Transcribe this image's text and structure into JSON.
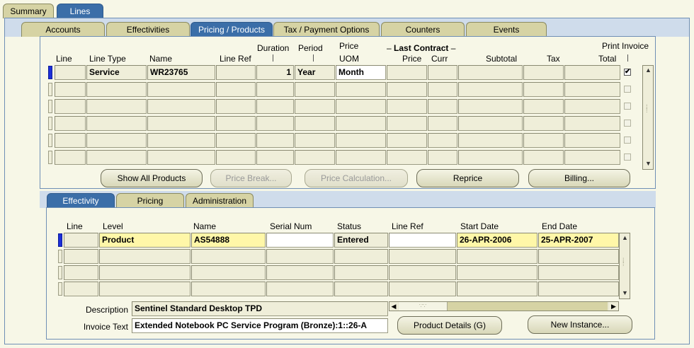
{
  "top_tabs": [
    {
      "label": "Summary",
      "selected": false
    },
    {
      "label": "Lines",
      "selected": true
    }
  ],
  "sub_tabs": [
    {
      "label": "Accounts"
    },
    {
      "label": "Effectivities"
    },
    {
      "label": "Pricing / Products",
      "selected": true
    },
    {
      "label": "Tax / Payment Options"
    },
    {
      "label": "Counters"
    },
    {
      "label": "Events"
    }
  ],
  "lines_grid": {
    "headers": {
      "line": "Line",
      "line_type": "Line Type",
      "name": "Name",
      "line_ref": "Line Ref",
      "duration": "Duration",
      "period": "Period",
      "price_top": "Price",
      "uom": "UOM",
      "last_contract": "Last Contract",
      "price": "Price",
      "curr": "Curr",
      "subtotal": "Subtotal",
      "tax": "Tax",
      "total": "Total",
      "print_invoice": "Print Invoice"
    },
    "row1": {
      "line_type": "Service",
      "name": "WR23765",
      "line_ref": "",
      "duration": "1",
      "period": "Year",
      "uom": "Month",
      "print_invoice": "✔"
    }
  },
  "buttons": {
    "show_all_products": "Show All Products",
    "price_break": "Price Break...",
    "price_calculation": "Price Calculation...",
    "reprice": "Reprice",
    "billing": "Billing...",
    "product_details": "Product Details (G)",
    "new_instance": "New Instance..."
  },
  "lower_tabs": [
    {
      "label": "Effectivity",
      "selected": true
    },
    {
      "label": "Pricing"
    },
    {
      "label": "Administration"
    }
  ],
  "lower_grid": {
    "headers": {
      "line": "Line",
      "level": "Level",
      "name": "Name",
      "serial_num": "Serial Num",
      "status": "Status",
      "line_ref": "Line Ref",
      "start_date": "Start Date",
      "end_date": "End Date"
    },
    "row1": {
      "level": "Product",
      "name": "AS54888",
      "serial_num": "",
      "status": "Entered",
      "line_ref": "",
      "start_date": "26-APR-2006",
      "end_date": "25-APR-2007"
    }
  },
  "detail": {
    "description_label": "Description",
    "description_value": "Sentinel Standard Desktop TPD",
    "invoice_text_label": "Invoice Text",
    "invoice_text_value": "Extended Notebook PC Service Program (Bronze):1::26-A"
  },
  "colors": {
    "tab_selected": "#3b6ea8",
    "tab_unselected": "#d6d3a4",
    "panel_background": "#f7f7e7",
    "required_field": "#fff7a8",
    "active_row_marker": "#1c2fd8"
  }
}
